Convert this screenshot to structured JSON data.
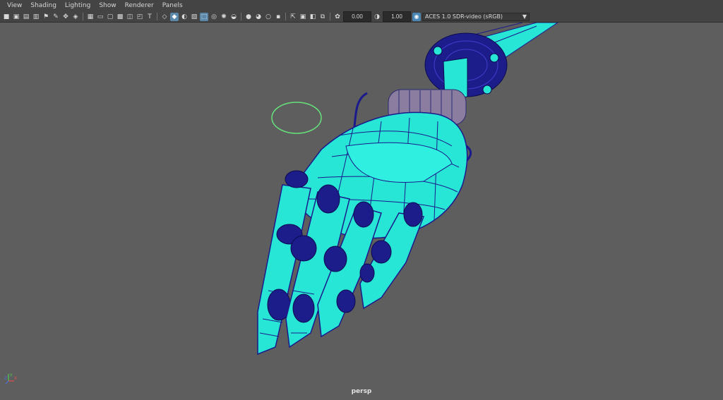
{
  "menubar": {
    "items": [
      {
        "label": "View"
      },
      {
        "label": "Shading"
      },
      {
        "label": "Lighting"
      },
      {
        "label": "Show"
      },
      {
        "label": "Renderer"
      },
      {
        "label": "Panels"
      }
    ]
  },
  "toolbar": {
    "exposure_value": "0.00",
    "gamma_value": "1.00",
    "colorspace_selected": "ACES 1.0 SDR-video (sRGB)",
    "colors": {
      "accent": "#5b87a8",
      "mesh_fill": "#27e6d6",
      "wire": "#1a1a8c"
    }
  },
  "viewport": {
    "camera_label": "persp",
    "axis": {
      "x": "X",
      "y": "Y",
      "z": "Z"
    }
  }
}
